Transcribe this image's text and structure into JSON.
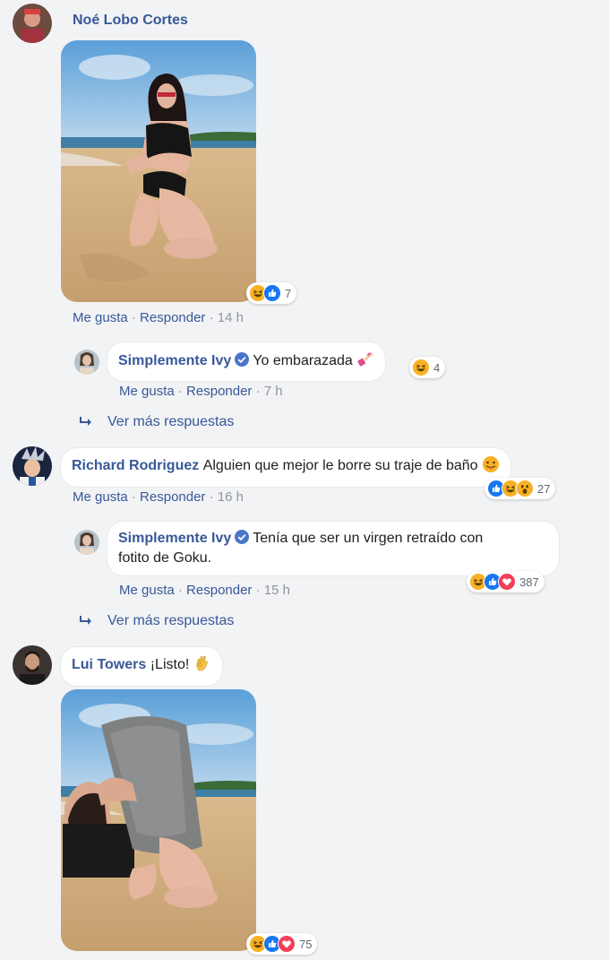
{
  "colors": {
    "link": "#385898",
    "background": "#f2f3f5",
    "like_blue": "#1877f2",
    "love_red": "#f33e58",
    "haha_yellow": "#f7b125"
  },
  "comments": [
    {
      "author": "Noé Lobo Cortes",
      "text": "",
      "attachment": "photo-beach-bikini",
      "reactions": {
        "icons": [
          "haha-icon",
          "like-icon"
        ],
        "count": "7"
      },
      "actions": {
        "like": "Me gusta",
        "reply": "Responder",
        "time": "14 h"
      },
      "reply": {
        "author": "Simplemente Ivy",
        "verified": true,
        "text": "Yo embarazada",
        "emoji": "nail-polish-icon",
        "reactions": {
          "icons": [
            "haha-icon"
          ],
          "count": "4"
        },
        "actions": {
          "like": "Me gusta",
          "reply": "Responder",
          "time": "7 h"
        }
      },
      "more_replies": "Ver más respuestas"
    },
    {
      "author": "Richard Rodriguez",
      "text": "Alguien que mejor le borre su traje de baño",
      "emoji": "tongue-out-icon",
      "reactions": {
        "icons": [
          "like-icon",
          "haha-icon",
          "wow-icon"
        ],
        "count": "27"
      },
      "actions": {
        "like": "Me gusta",
        "reply": "Responder",
        "time": "16 h"
      },
      "reply": {
        "author": "Simplemente Ivy",
        "verified": true,
        "text_line1": "Tenía que ser un virgen retraído con",
        "text_line2": "fotito de Goku.",
        "reactions": {
          "icons": [
            "haha-icon",
            "like-icon",
            "love-icon"
          ],
          "count": "387"
        },
        "actions": {
          "like": "Me gusta",
          "reply": "Responder",
          "time": "15 h"
        }
      },
      "more_replies": "Ver más respuestas"
    },
    {
      "author": "Lui Towers",
      "text": "¡Listo!",
      "emoji": "ok-hand-icon",
      "attachment": "photo-beach-edited",
      "reactions": {
        "icons": [
          "haha-icon",
          "like-icon",
          "love-icon"
        ],
        "count": "75"
      }
    }
  ]
}
